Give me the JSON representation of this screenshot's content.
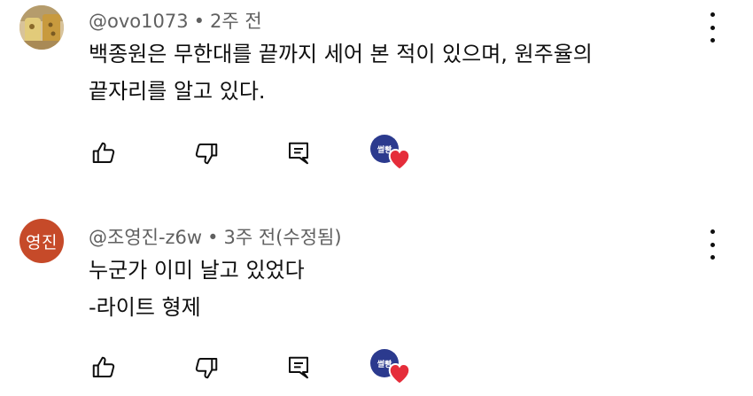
{
  "comments": [
    {
      "author": "@ovo1073",
      "separator": "•",
      "time": "2주 전",
      "lines": [
        "백종원은 무한대를 끝까지 세어 본 적이 있으며, 원주율의",
        "끝자리를 알고 있다."
      ],
      "avatar_icon": "profile-photo-icon",
      "creator_heart_icon": "creator-heart-icon",
      "creator_badge_text": "썰빵"
    },
    {
      "author": "@조영진-z6w",
      "separator": "•",
      "time": "3주 전(수정됨)",
      "avatar_text": "영진",
      "lines": [
        "누군가 이미 날고 있었다",
        "-라이트 형제"
      ],
      "creator_heart_icon": "creator-heart-icon",
      "creator_badge_text": "썰빵"
    }
  ],
  "colors": {
    "avatar2_bg": "#c64a29",
    "creator_avatar_bg": "#2b3a8e",
    "heart": "#e52d3a",
    "meta_text": "#606060"
  }
}
